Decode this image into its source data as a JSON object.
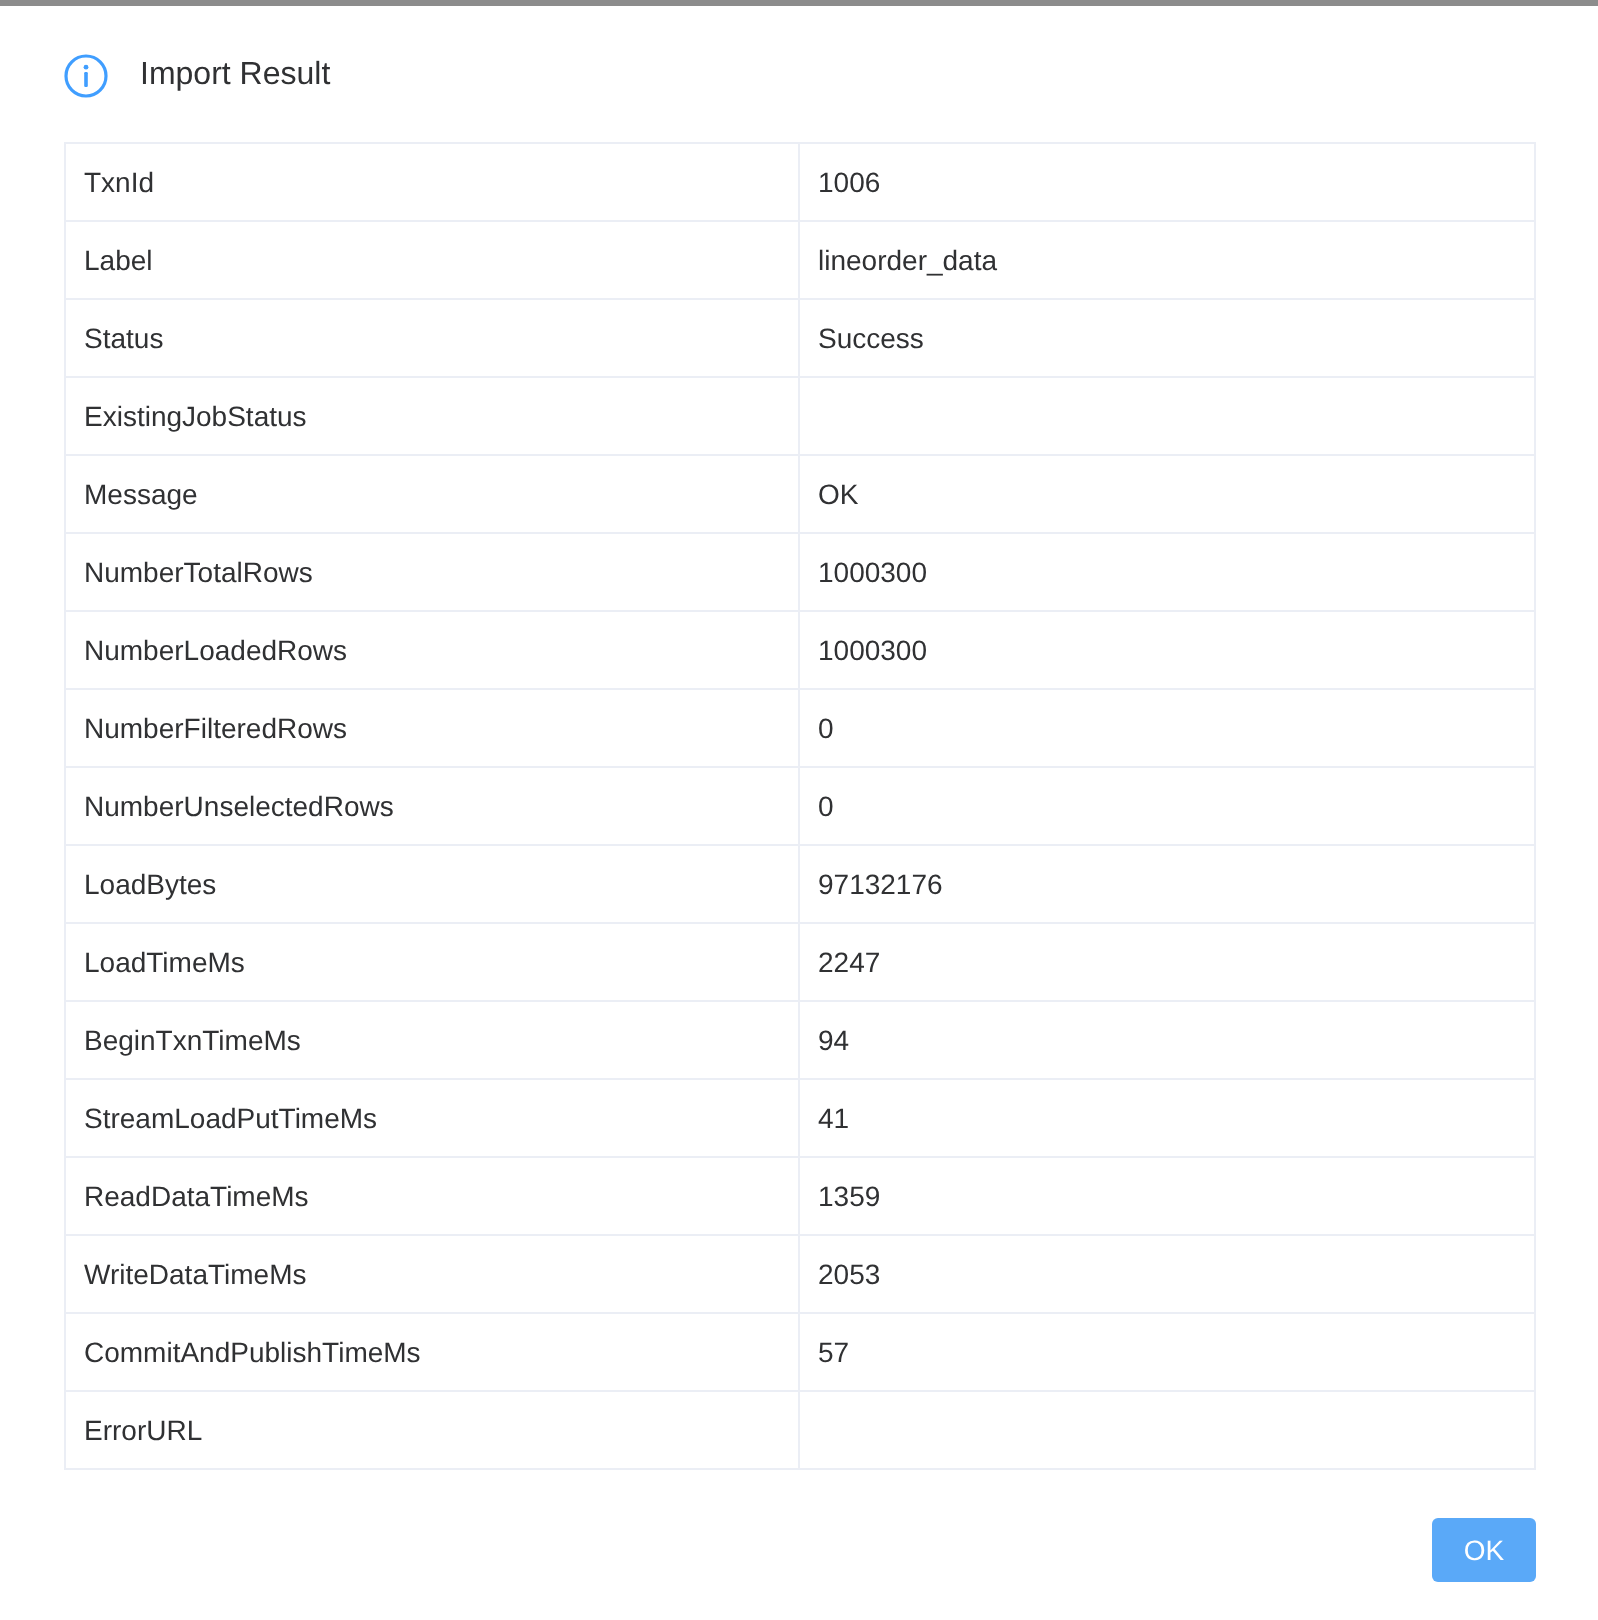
{
  "dialog": {
    "title": "Import Result"
  },
  "table": {
    "rows": [
      {
        "key": "TxnId",
        "value": "1006"
      },
      {
        "key": "Label",
        "value": "lineorder_data"
      },
      {
        "key": "Status",
        "value": "Success"
      },
      {
        "key": "ExistingJobStatus"
      },
      {
        "key": "Message",
        "value": "OK"
      },
      {
        "key": "NumberTotalRows",
        "value": "1000300"
      },
      {
        "key": "NumberLoadedRows",
        "value": "1000300"
      },
      {
        "key": "NumberFilteredRows",
        "value": "0"
      },
      {
        "key": "NumberUnselectedRows",
        "value": "0"
      },
      {
        "key": "LoadBytes",
        "value": "97132176"
      },
      {
        "key": "LoadTimeMs",
        "value": "2247"
      },
      {
        "key": "BeginTxnTimeMs",
        "value": "94"
      },
      {
        "key": "StreamLoadPutTimeMs",
        "value": "41"
      },
      {
        "key": "ReadDataTimeMs",
        "value": "1359"
      },
      {
        "key": "WriteDataTimeMs",
        "value": "2053"
      },
      {
        "key": "CommitAndPublishTimeMs",
        "value": "57"
      },
      {
        "key": "ErrorURL"
      }
    ]
  },
  "buttons": [
    {
      "label": "OK"
    }
  ]
}
